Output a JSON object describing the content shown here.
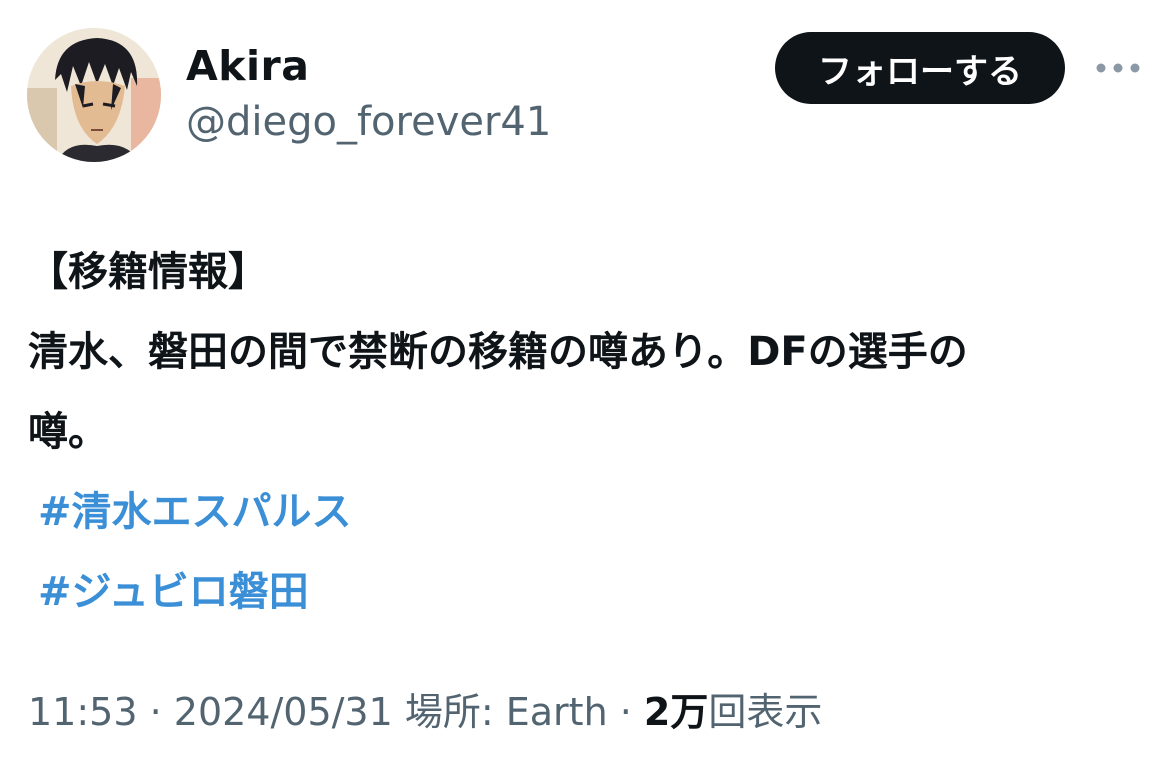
{
  "user": {
    "display_name": "Akira",
    "handle": "@diego_forever41"
  },
  "actions": {
    "follow_label": "フォローする",
    "more_icon": "more-horizontal-icon"
  },
  "tweet": {
    "heading": "【移籍情報】",
    "line1": "清水、磐田の間で禁断の移籍の噂あり。DFの選手の",
    "line2": "噂。",
    "hashtags": [
      "#清水エスパルス",
      "#ジュビロ磐田"
    ]
  },
  "meta": {
    "time": "11:53",
    "sep1": " · ",
    "date": "2024/05/31",
    "location": " 場所: Earth",
    "sep2": " · ",
    "views_count": "2万",
    "views_label": "回表示"
  },
  "colors": {
    "hashtag": "#3b8fd6",
    "secondary_text": "#536471",
    "follow_button_bg": "#0f1419"
  }
}
